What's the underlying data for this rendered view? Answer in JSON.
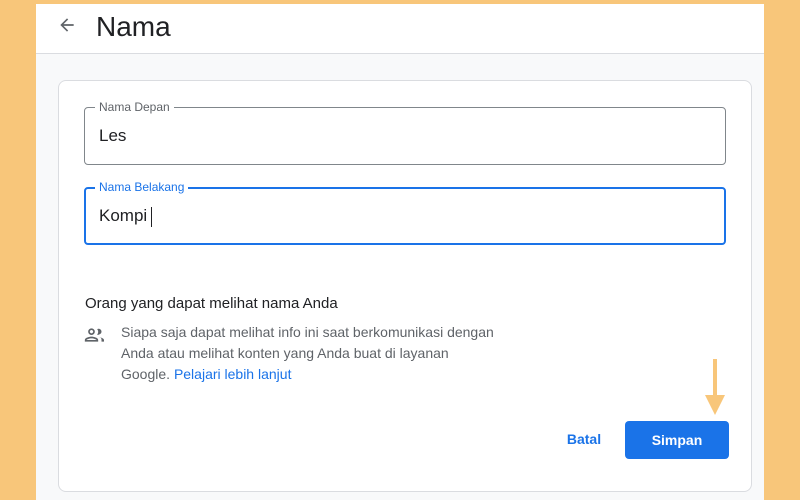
{
  "header": {
    "title": "Nama",
    "back_icon": "arrow-left-icon"
  },
  "form": {
    "first_name": {
      "label": "Nama Depan",
      "value": "Les"
    },
    "last_name": {
      "label": "Nama Belakang",
      "value": "Kompi"
    }
  },
  "visibility": {
    "title": "Orang yang dapat melihat nama Anda",
    "description": "Siapa saja dapat melihat info ini saat berkomunikasi dengan Anda atau melihat konten yang Anda buat di layanan Google.",
    "learn_more": "Pelajari lebih lanjut",
    "icon": "people-icon"
  },
  "actions": {
    "cancel": "Batal",
    "save": "Simpan"
  },
  "annotation": {
    "arrow_icon": "down-arrow-icon",
    "color": "#f8c67a"
  },
  "colors": {
    "accent": "#1a73e8",
    "background": "#f8c67a"
  }
}
